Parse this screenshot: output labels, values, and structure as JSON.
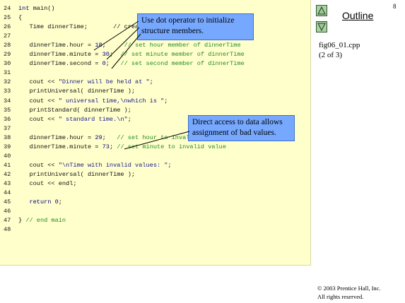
{
  "page_number": "8",
  "outline": {
    "title": "Outline",
    "file": "fig06_01.cpp",
    "part": "(2 of 3)"
  },
  "code": {
    "lines": [
      {
        "num": "24",
        "segs": [
          {
            "t": "int",
            "c": "kw"
          },
          {
            "t": " main()"
          }
        ]
      },
      {
        "num": "25",
        "segs": [
          {
            "t": "{"
          }
        ]
      },
      {
        "num": "26",
        "segs": [
          {
            "t": "   Time dinnerTime;       // create object of type Time"
          }
        ]
      },
      {
        "num": "27",
        "segs": [
          {
            "t": ""
          }
        ]
      },
      {
        "num": "28",
        "segs": [
          {
            "t": "   dinnerTime.hour = "
          },
          {
            "t": "18",
            "c": "kw"
          },
          {
            "t": ";     "
          },
          {
            "t": "// set hour member of dinnerTime",
            "c": "cm"
          }
        ]
      },
      {
        "num": "29",
        "segs": [
          {
            "t": "   dinnerTime.minute = "
          },
          {
            "t": "30",
            "c": "kw"
          },
          {
            "t": ";  "
          },
          {
            "t": "// set minute member of dinnerTime",
            "c": "cm"
          }
        ]
      },
      {
        "num": "30",
        "segs": [
          {
            "t": "   dinnerTime.second = "
          },
          {
            "t": "0",
            "c": "kw"
          },
          {
            "t": ";   "
          },
          {
            "t": "// set second member of dinnerTime",
            "c": "cm"
          }
        ]
      },
      {
        "num": "31",
        "segs": [
          {
            "t": ""
          }
        ]
      },
      {
        "num": "32",
        "segs": [
          {
            "t": "   cout << "
          },
          {
            "t": "\"Dinner will be held at \"",
            "c": "st"
          },
          {
            "t": ";"
          }
        ]
      },
      {
        "num": "33",
        "segs": [
          {
            "t": "   printUniversal( dinnerTime );"
          }
        ]
      },
      {
        "num": "34",
        "segs": [
          {
            "t": "   cout << "
          },
          {
            "t": "\" universal time,\\nwhich is \"",
            "c": "st"
          },
          {
            "t": ";"
          }
        ]
      },
      {
        "num": "35",
        "segs": [
          {
            "t": "   printStandard( dinnerTime );"
          }
        ]
      },
      {
        "num": "36",
        "segs": [
          {
            "t": "   cout << "
          },
          {
            "t": "\" standard time.\\n\"",
            "c": "st"
          },
          {
            "t": ";"
          }
        ]
      },
      {
        "num": "37",
        "segs": [
          {
            "t": ""
          }
        ]
      },
      {
        "num": "38",
        "segs": [
          {
            "t": "   dinnerTime.hour = "
          },
          {
            "t": "29",
            "c": "kw"
          },
          {
            "t": ";   "
          },
          {
            "t": "// set hour to invalid value",
            "c": "cm"
          }
        ]
      },
      {
        "num": "39",
        "segs": [
          {
            "t": "   dinnerTime.minute = "
          },
          {
            "t": "73",
            "c": "kw"
          },
          {
            "t": "; "
          },
          {
            "t": "// set minute to invalid value",
            "c": "cm"
          }
        ]
      },
      {
        "num": "40",
        "segs": [
          {
            "t": ""
          }
        ]
      },
      {
        "num": "41",
        "segs": [
          {
            "t": "   cout << "
          },
          {
            "t": "\"\\nTime with invalid values: \"",
            "c": "st"
          },
          {
            "t": ";"
          }
        ]
      },
      {
        "num": "42",
        "segs": [
          {
            "t": "   printUniversal( dinnerTime );"
          }
        ]
      },
      {
        "num": "43",
        "segs": [
          {
            "t": "   cout << endl;"
          }
        ]
      },
      {
        "num": "44",
        "segs": [
          {
            "t": ""
          }
        ]
      },
      {
        "num": "45",
        "segs": [
          {
            "t": "   "
          },
          {
            "t": "return",
            "c": "kw"
          },
          {
            "t": " "
          },
          {
            "t": "0",
            "c": "kw"
          },
          {
            "t": ";"
          }
        ]
      },
      {
        "num": "46",
        "segs": [
          {
            "t": ""
          }
        ]
      },
      {
        "num": "47",
        "segs": [
          {
            "t": "} "
          },
          {
            "t": "// end main",
            "c": "cm"
          }
        ]
      },
      {
        "num": "48",
        "segs": [
          {
            "t": ""
          }
        ]
      }
    ]
  },
  "callouts": {
    "dot_operator": {
      "line1": "Use dot operator to initialize",
      "line2": "structure members."
    },
    "direct_access": {
      "line1": "Direct access to data allows",
      "line2": "assignment of bad values."
    }
  },
  "copyright": {
    "line1": "© 2003 Prentice Hall, Inc.",
    "line2": "All rights reserved."
  }
}
